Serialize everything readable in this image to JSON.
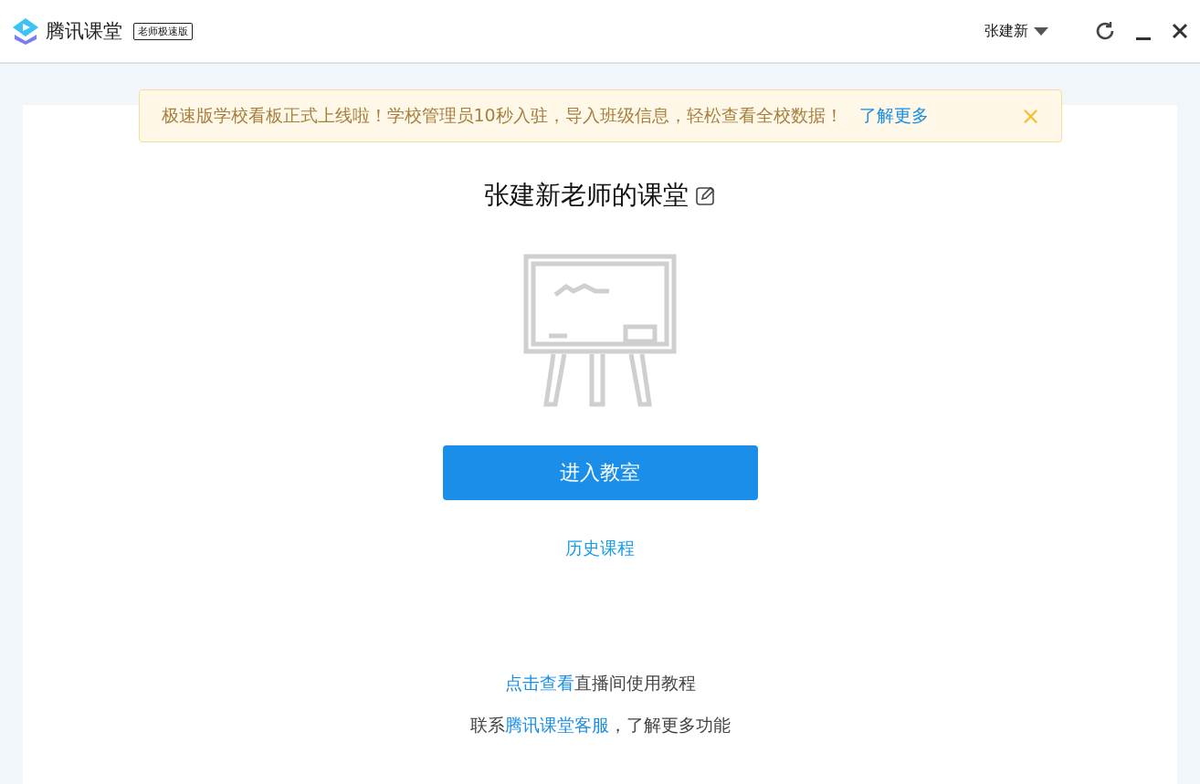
{
  "header": {
    "app_name": "腾讯课堂",
    "edition_badge": "老师极速版",
    "user_name": "张建新"
  },
  "notice": {
    "text": "极速版学校看板正式上线啦！学校管理员10秒入驻，导入班级信息，轻松查看全校数据！",
    "link": "了解更多",
    "close": "×"
  },
  "classroom": {
    "title": "张建新老师的课堂",
    "enter_button": "进入教室",
    "history_link": "历史课程"
  },
  "help_lines": [
    {
      "link": "点击查看",
      "suffix": "直播间使用教程"
    },
    {
      "prefix": "联系",
      "link": "腾讯课堂客服",
      "suffix": "，了解更多功能"
    }
  ]
}
